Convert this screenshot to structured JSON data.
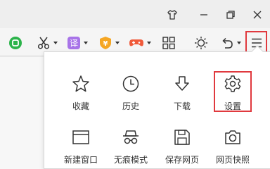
{
  "window": {
    "controls": [
      {
        "name": "skin-icon"
      },
      {
        "name": "minimize-icon"
      },
      {
        "name": "restore-icon"
      },
      {
        "name": "close-icon"
      }
    ]
  },
  "toolbar": {
    "items": [
      {
        "name": "green-app-icon",
        "color": "#2bb34a"
      },
      {
        "name": "scissors-icon",
        "has_dropdown": true
      },
      {
        "name": "translate-icon",
        "glyph": "译",
        "color": "#a874e8",
        "has_dropdown": true
      },
      {
        "name": "shield-yen-icon",
        "glyph": "¥",
        "color": "#f5a623",
        "has_dropdown": true
      },
      {
        "name": "gamepad-icon",
        "color": "#f05a3a",
        "has_dropdown": true
      },
      {
        "name": "apps-grid-icon"
      },
      {
        "name": "brightness-icon"
      },
      {
        "name": "undo-icon",
        "has_dropdown": true
      },
      {
        "name": "menu-icon",
        "highlighted": true
      }
    ]
  },
  "menu": {
    "items": [
      {
        "label": "收藏",
        "icon": "star-icon"
      },
      {
        "label": "历史",
        "icon": "clock-icon"
      },
      {
        "label": "下载",
        "icon": "download-icon"
      },
      {
        "label": "设置",
        "icon": "gear-icon",
        "highlighted": true
      },
      {
        "label": "新建窗口",
        "icon": "new-window-icon"
      },
      {
        "label": "无痕模式",
        "icon": "incognito-icon"
      },
      {
        "label": "保存网页",
        "icon": "save-icon"
      },
      {
        "label": "网页快照",
        "icon": "camera-icon"
      }
    ]
  },
  "colors": {
    "highlight": "#e0393e",
    "panel_bg": "#ffffff",
    "toolbar_bg": "#f5f5f5"
  }
}
